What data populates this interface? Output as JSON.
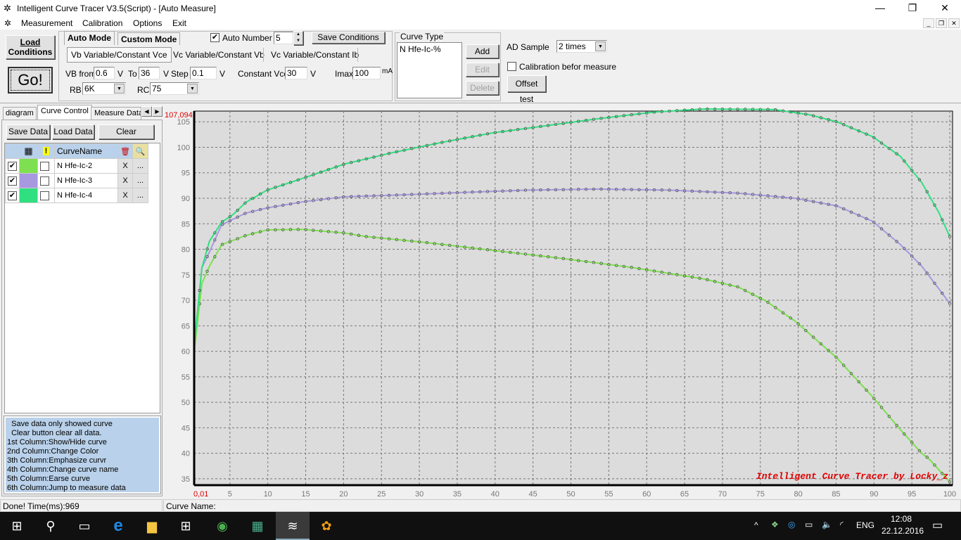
{
  "window": {
    "title": "Intelligent Curve Tracer V3.5(Script) - [Auto Measure]"
  },
  "menu": [
    "Measurement",
    "Calibration",
    "Options",
    "Exit"
  ],
  "toolbar": {
    "load_conditions_1": "Load",
    "load_conditions_2": "Conditions",
    "go": "Go!",
    "mode_tabs": [
      "Auto Mode",
      "Custom Mode"
    ],
    "auto_number_label": "Auto Number",
    "auto_number_checked": true,
    "auto_number_value": "5",
    "save_conditions": "Save Conditions",
    "sub_tabs": [
      "Vb Variable/Constant Vce",
      "Vc Variable/Constant Vb",
      "Vc Variable/Constant Ib"
    ],
    "vb_from_label": "VB from",
    "vb_from": "0.6",
    "v1": "V",
    "to_label": "To",
    "to": "36",
    "v2": "V",
    "step_label": "Step",
    "step": "0.1",
    "v3": "V",
    "const_vce_label": "Constant Vce",
    "const_vce": "30",
    "v4": "V",
    "imax_label": "Imax",
    "imax": "100",
    "ma": "mA",
    "rb_label": "RB",
    "rb": "6K",
    "rc_label": "RC",
    "rc": "75"
  },
  "curve_type": {
    "legend": "Curve Type",
    "items": [
      "N Hfe-Ic-%"
    ],
    "add": "Add",
    "edit": "Edit",
    "delete": "Delete"
  },
  "ad": {
    "label": "AD Sample",
    "value": "2 times",
    "calib_label": "Calibration befor measure",
    "calib_checked": false,
    "offset": "Offset test"
  },
  "left": {
    "tabs": [
      "diagram",
      "Curve Control",
      "Measure Data"
    ],
    "save": "Save Data",
    "load": "Load Data",
    "clear": "Clear",
    "col_name": "CurveName",
    "rows": [
      {
        "show": true,
        "color": "#7ee050",
        "emph": false,
        "name": "N Hfe-Ic-2",
        "x": "X",
        "dots": "..."
      },
      {
        "show": true,
        "color": "#a898e0",
        "emph": false,
        "name": "N Hfe-Ic-3",
        "x": "X",
        "dots": "..."
      },
      {
        "show": true,
        "color": "#30e080",
        "emph": false,
        "name": "N Hfe-Ic-4",
        "x": "X",
        "dots": "..."
      }
    ],
    "help": [
      "  Save data only showed curve",
      "  Clear button clear all data.",
      "1st Column:Show/Hide curve",
      "2nd Column:Change Color",
      "3th Column:Emphasize curvr",
      "4th Column:Change curve name",
      "5th Column:Earse curve",
      "6th Column:Jump to measure data"
    ]
  },
  "status": {
    "left": "Done!  Time(ms):969",
    "right": "Curve Name:"
  },
  "taskbar": {
    "lang": "ENG",
    "time": "12:08",
    "date": "22.12.2016"
  },
  "chart_data": {
    "type": "line",
    "title": "",
    "xlabel": "",
    "ylabel": "",
    "xlim": [
      0,
      100
    ],
    "ylim": [
      33.75,
      107.094
    ],
    "y_max_label": "107,094",
    "x_min_label": "0,01",
    "xticks": [
      5,
      10,
      15,
      20,
      25,
      30,
      35,
      40,
      45,
      50,
      55,
      60,
      65,
      70,
      75,
      80,
      85,
      90,
      95,
      100
    ],
    "yticks": [
      35,
      40,
      45,
      50,
      55,
      60,
      65,
      70,
      75,
      80,
      85,
      90,
      95,
      100,
      105
    ],
    "grid": true,
    "watermark": "Intelligent Curve Tracer by Locky_z",
    "series": [
      {
        "name": "N Hfe-Ic-2",
        "color": "#7ee050",
        "points": [
          [
            0.3,
            60
          ],
          [
            1.3,
            73.3
          ],
          [
            2.3,
            76.7
          ],
          [
            3.9,
            80.9
          ],
          [
            7.1,
            82.7
          ],
          [
            9.9,
            83.8
          ],
          [
            14.6,
            83.9
          ],
          [
            20.1,
            83.2
          ],
          [
            22.9,
            82.5
          ],
          [
            30.4,
            81.4
          ],
          [
            39.6,
            79.8
          ],
          [
            48.9,
            78.2
          ],
          [
            58.2,
            76.4
          ],
          [
            67.5,
            74.2
          ],
          [
            72.1,
            72.6
          ],
          [
            75.8,
            69.8
          ],
          [
            79.6,
            65.9
          ],
          [
            85.1,
            58.7
          ],
          [
            89.8,
            51.1
          ],
          [
            93.5,
            44.6
          ],
          [
            96.3,
            40
          ],
          [
            97.2,
            39
          ],
          [
            100,
            34.4
          ]
        ]
      },
      {
        "name": "N Hfe-Ic-3",
        "color": "#a898e0",
        "points": [
          [
            0.3,
            61.5
          ],
          [
            1.3,
            76.4
          ],
          [
            2.3,
            79.5
          ],
          [
            3.9,
            84.8
          ],
          [
            7.1,
            87.1
          ],
          [
            9.9,
            88.1
          ],
          [
            14.6,
            89.3
          ],
          [
            20.1,
            90.3
          ],
          [
            26.6,
            90.6
          ],
          [
            35,
            91.1
          ],
          [
            44.3,
            91.6
          ],
          [
            53.6,
            91.8
          ],
          [
            62.9,
            91.6
          ],
          [
            72.1,
            91
          ],
          [
            79.6,
            90
          ],
          [
            85.1,
            88.5
          ],
          [
            89.8,
            85.5
          ],
          [
            93.5,
            80.9
          ],
          [
            96.3,
            76.7
          ],
          [
            100,
            69.4
          ]
        ]
      },
      {
        "name": "N Hfe-Ic-4",
        "color": "#30e080",
        "points": [
          [
            0.3,
            61.5
          ],
          [
            1.3,
            76.4
          ],
          [
            2.3,
            81.6
          ],
          [
            3.9,
            85.3
          ],
          [
            5.4,
            86.8
          ],
          [
            7.1,
            89.2
          ],
          [
            9.9,
            91.6
          ],
          [
            14.6,
            93.9
          ],
          [
            20.1,
            96.7
          ],
          [
            26.6,
            99
          ],
          [
            33.1,
            101
          ],
          [
            39.6,
            102.8
          ],
          [
            47.1,
            104.3
          ],
          [
            53.6,
            105.6
          ],
          [
            61,
            106.9
          ],
          [
            67.5,
            107.5
          ],
          [
            76.8,
            107.4
          ],
          [
            81.4,
            106.4
          ],
          [
            85.1,
            105
          ],
          [
            89.8,
            102.1
          ],
          [
            93.5,
            98.2
          ],
          [
            96.3,
            93.1
          ],
          [
            98.6,
            87.1
          ],
          [
            100,
            82.5
          ]
        ]
      }
    ]
  }
}
